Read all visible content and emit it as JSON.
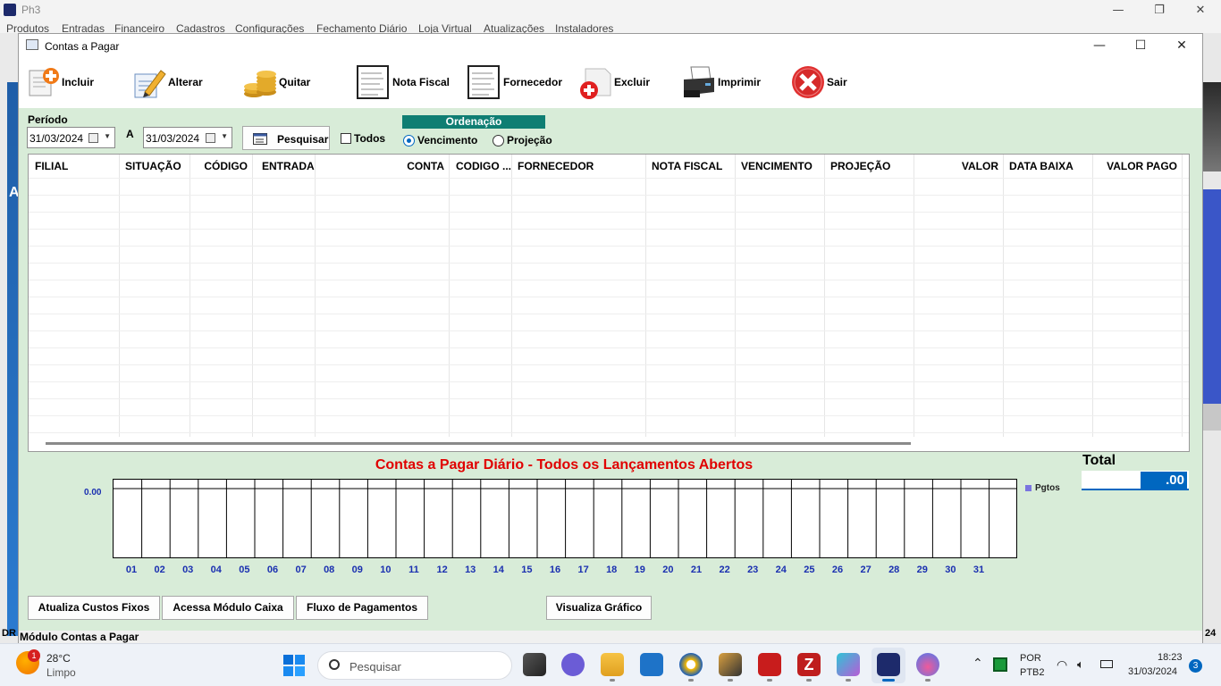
{
  "outer": {
    "title": "Ph3",
    "menu": [
      "Produtos",
      "Entradas",
      "Financeiro",
      "Cadastros",
      "Configurações",
      "Fechamento Diário",
      "Loja Virtual",
      "Atualizações",
      "Instaladores"
    ],
    "edge_left_a": "A",
    "edge_left_dr": "DR",
    "edge_right_24": "24"
  },
  "window": {
    "title": "Contas a Pagar"
  },
  "toolbar": [
    {
      "label": "Incluir",
      "icon": "add-document-icon"
    },
    {
      "label": "Alterar",
      "icon": "edit-pencil-icon"
    },
    {
      "label": "Quitar",
      "icon": "coins-icon"
    },
    {
      "label": "Nota Fiscal",
      "icon": "invoice-document-icon"
    },
    {
      "label": "Fornecedor",
      "icon": "supplier-document-icon"
    },
    {
      "label": "Excluir",
      "icon": "delete-icon"
    },
    {
      "label": "Imprimir",
      "icon": "printer-icon"
    },
    {
      "label": "Sair",
      "icon": "exit-icon"
    }
  ],
  "filter": {
    "periodo_label": "Período",
    "date_from": "31/03/2024",
    "a_label": "A",
    "date_to": "31/03/2024",
    "search_button": "Pesquisar",
    "todos_label": "Todos",
    "todos_checked": false,
    "ordenacao_label": "Ordenação",
    "vencimento_label": "Vencimento",
    "projecao_label": "Projeção",
    "selected_order": "Vencimento"
  },
  "grid": {
    "columns": [
      "FILIAL",
      "SITUAÇÃO",
      "CÓDIGO",
      "ENTRADA",
      "CONTA",
      "CODIGO ...",
      "FORNECEDOR",
      "NOTA FISCAL",
      "VENCIMENTO",
      "PROJEÇÃO",
      "VALOR",
      "DATA BAIXA",
      "VALOR PAGO"
    ],
    "rows": []
  },
  "chart_data": {
    "type": "bar",
    "title": "Contas a Pagar Diário - Todos os Lançamentos Abertos",
    "categories": [
      "01",
      "02",
      "03",
      "04",
      "05",
      "06",
      "07",
      "08",
      "09",
      "10",
      "11",
      "12",
      "13",
      "14",
      "15",
      "16",
      "17",
      "18",
      "19",
      "20",
      "21",
      "22",
      "23",
      "24",
      "25",
      "26",
      "27",
      "28",
      "29",
      "30",
      "31"
    ],
    "series": [
      {
        "name": "Pgtos",
        "values": [
          0,
          0,
          0,
          0,
          0,
          0,
          0,
          0,
          0,
          0,
          0,
          0,
          0,
          0,
          0,
          0,
          0,
          0,
          0,
          0,
          0,
          0,
          0,
          0,
          0,
          0,
          0,
          0,
          0,
          0,
          0
        ]
      }
    ],
    "y_tick_labels": [
      "0.00"
    ],
    "legend_position": "right",
    "accent_color": "#7a74e0"
  },
  "total": {
    "label": "Total",
    "value": ".00"
  },
  "bottom_buttons": [
    "Atualiza Custos Fixos",
    "Acessa Módulo Caixa",
    "Fluxo de Pagamentos",
    "Visualiza Gráfico"
  ],
  "status": "Módulo Contas a Pagar",
  "taskbar": {
    "weather_temp": "28°C",
    "weather_desc": "Limpo",
    "weather_badge": "1",
    "search_placeholder": "Pesquisar",
    "lang_line1": "POR",
    "lang_line2": "PTB2",
    "time": "18:23",
    "date": "31/03/2024",
    "notification_count": "3"
  }
}
